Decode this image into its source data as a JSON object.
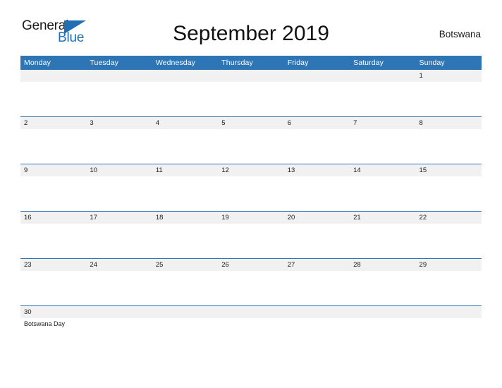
{
  "brand": {
    "word_one": "General",
    "word_two": "Blue",
    "triangle_icon": "triangle-icon",
    "accent_color": "#1f6fb2"
  },
  "header": {
    "title": "September 2019",
    "locale": "Botswana"
  },
  "theme": {
    "header_blue": "#2e75b6",
    "row_band": "#f1f1f1",
    "separator": "#2e75b6",
    "text": "#1a1a1a",
    "page_background": "#ffffff"
  },
  "calendar": {
    "weekday_headers": [
      "Monday",
      "Tuesday",
      "Wednesday",
      "Thursday",
      "Friday",
      "Saturday",
      "Sunday"
    ],
    "weeks": [
      [
        {
          "date": "",
          "events": []
        },
        {
          "date": "",
          "events": []
        },
        {
          "date": "",
          "events": []
        },
        {
          "date": "",
          "events": []
        },
        {
          "date": "",
          "events": []
        },
        {
          "date": "",
          "events": []
        },
        {
          "date": "1",
          "events": []
        }
      ],
      [
        {
          "date": "2",
          "events": []
        },
        {
          "date": "3",
          "events": []
        },
        {
          "date": "4",
          "events": []
        },
        {
          "date": "5",
          "events": []
        },
        {
          "date": "6",
          "events": []
        },
        {
          "date": "7",
          "events": []
        },
        {
          "date": "8",
          "events": []
        }
      ],
      [
        {
          "date": "9",
          "events": []
        },
        {
          "date": "10",
          "events": []
        },
        {
          "date": "11",
          "events": []
        },
        {
          "date": "12",
          "events": []
        },
        {
          "date": "13",
          "events": []
        },
        {
          "date": "14",
          "events": []
        },
        {
          "date": "15",
          "events": []
        }
      ],
      [
        {
          "date": "16",
          "events": []
        },
        {
          "date": "17",
          "events": []
        },
        {
          "date": "18",
          "events": []
        },
        {
          "date": "19",
          "events": []
        },
        {
          "date": "20",
          "events": []
        },
        {
          "date": "21",
          "events": []
        },
        {
          "date": "22",
          "events": []
        }
      ],
      [
        {
          "date": "23",
          "events": []
        },
        {
          "date": "24",
          "events": []
        },
        {
          "date": "25",
          "events": []
        },
        {
          "date": "26",
          "events": []
        },
        {
          "date": "27",
          "events": []
        },
        {
          "date": "28",
          "events": []
        },
        {
          "date": "29",
          "events": []
        }
      ],
      [
        {
          "date": "30",
          "events": [
            "Botswana Day"
          ]
        },
        {
          "date": "",
          "events": []
        },
        {
          "date": "",
          "events": []
        },
        {
          "date": "",
          "events": []
        },
        {
          "date": "",
          "events": []
        },
        {
          "date": "",
          "events": []
        },
        {
          "date": "",
          "events": []
        }
      ]
    ]
  }
}
